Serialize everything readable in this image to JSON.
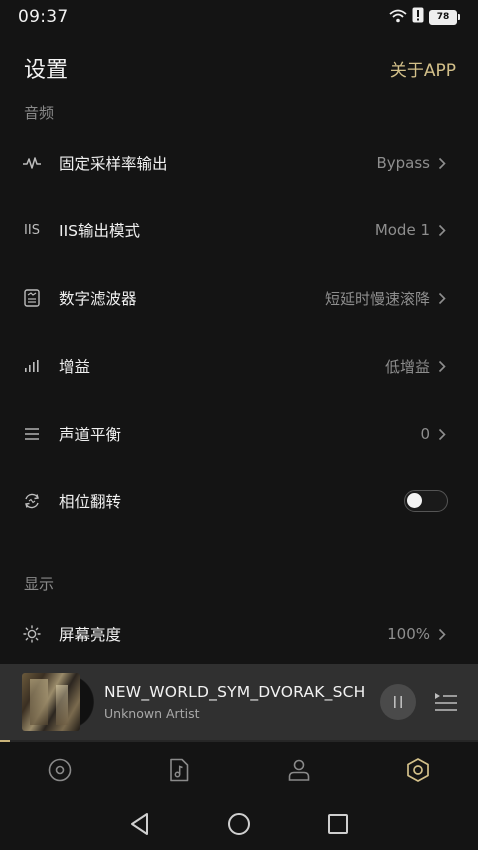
{
  "status_bar": {
    "time": "09:37",
    "battery": "78"
  },
  "header": {
    "title": "设置",
    "about": "关于APP"
  },
  "sections": {
    "audio": "音频",
    "display": "显示"
  },
  "settings": {
    "sample_rate": {
      "label": "固定采样率输出",
      "value": "Bypass"
    },
    "iis": {
      "icon_text": "IIS",
      "label": "IIS输出模式",
      "value": "Mode 1"
    },
    "filter": {
      "label": "数字滤波器",
      "value": "短延时慢速滚降"
    },
    "gain": {
      "label": "增益",
      "value": "低增益"
    },
    "balance": {
      "label": "声道平衡",
      "value": "0"
    },
    "phase": {
      "label": "相位翻转",
      "enabled": false
    },
    "brightness": {
      "label": "屏幕亮度",
      "value": "100%"
    }
  },
  "player": {
    "title": "NEW_WORLD_SYM_DVORAK_SCH. .",
    "artist": "Unknown Artist",
    "progress": 0.02,
    "state": "playing"
  },
  "tabs": [
    {
      "name": "disc",
      "active": false
    },
    {
      "name": "music-note",
      "active": false
    },
    {
      "name": "user",
      "active": false
    },
    {
      "name": "settings",
      "active": true
    }
  ],
  "colors": {
    "accent": "#d3c08a",
    "background": "#141414",
    "player_bg": "#303030"
  }
}
